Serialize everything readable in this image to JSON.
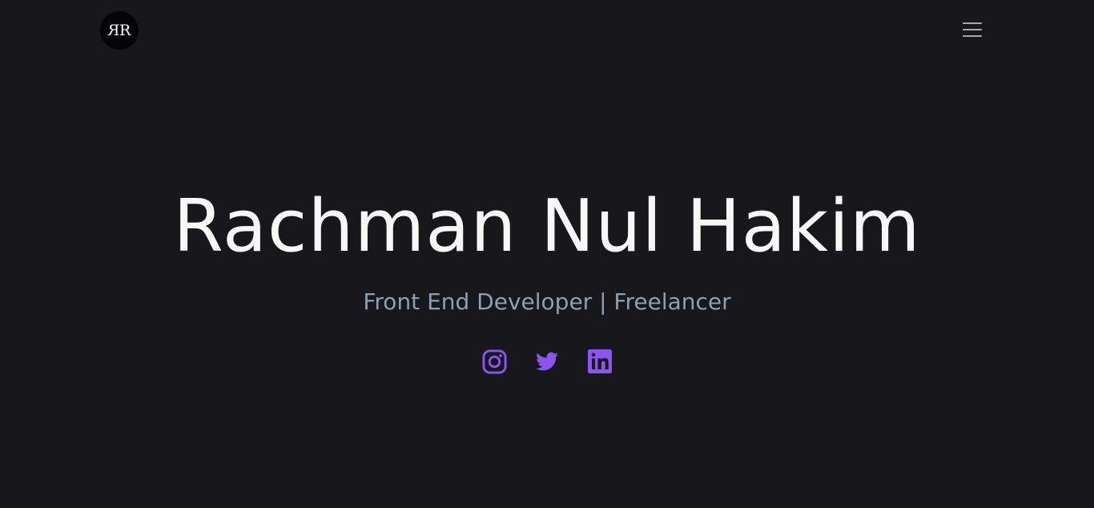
{
  "header": {
    "logo_monogram": "RR",
    "menu_icon": "hamburger-menu-icon"
  },
  "hero": {
    "name": "Rachman Nul Hakim",
    "role": "Front End Developer | Freelancer"
  },
  "socials": [
    {
      "icon": "instagram-icon"
    },
    {
      "icon": "twitter-icon"
    },
    {
      "icon": "linkedin-icon"
    }
  ],
  "colors": {
    "background": "#18171c",
    "accent": "#8a55f0",
    "name_text": "#f7f7f7",
    "role_text": "#8d9fb5",
    "menu_icon": "#a7a7ad"
  }
}
